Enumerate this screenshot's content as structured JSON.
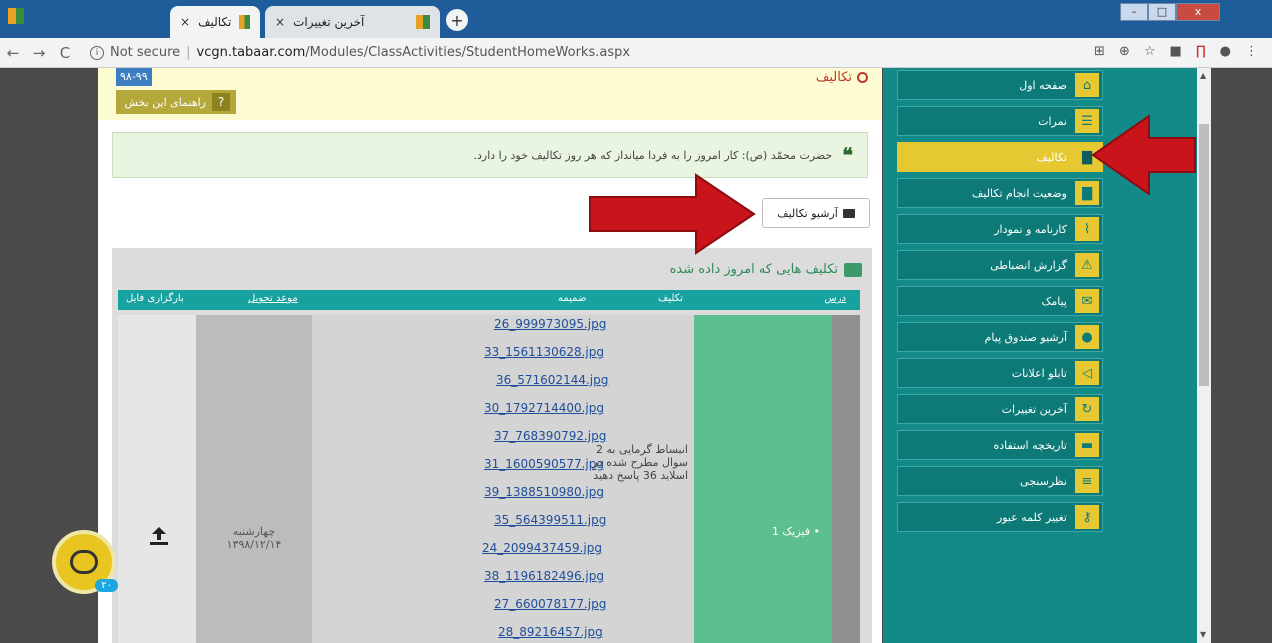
{
  "browser": {
    "tabs": [
      {
        "label": "تکالیف",
        "close": "×"
      },
      {
        "label": "آخرین تغییرات",
        "close": "×"
      }
    ],
    "new_tab": "+",
    "url_security": "Not secure",
    "url_host": "vcgn.tabaar.com",
    "url_path": "/Modules/ClassActivities/StudentHomeWorks.aspx",
    "window_controls": [
      "–",
      "□",
      "x"
    ]
  },
  "header": {
    "year_badge": "۹۸-۹۹",
    "help_label": "راهنمای این بخش",
    "help_icon": "?",
    "page_title": "تکالیف"
  },
  "quote": {
    "mark": "❝",
    "text": "حضرت محمّد (ص): کار امروز را به فردا میانداز که هر روز تکالیف خود را دارد."
  },
  "archive_button": {
    "label": "آرشیو تکالیف"
  },
  "homework": {
    "title": "تکلیف هایی که امروز داده شده",
    "columns": {
      "lesson": "درس",
      "assignment": "تکلیف",
      "attachment": "ضمیمه",
      "due": "موعد تحویل",
      "upload": "بارگزاری فایل"
    },
    "row": {
      "lesson": "فیزیک 1",
      "assignment": "انبساط گرمایی به 2 سوال مطرح شده در اسلاید 36 پاسخ دهید",
      "attachments": [
        "26_999973095.jpg",
        "33_1561130628.jpg",
        "36_571602144.jpg",
        "30_1792714400.jpg",
        "37_768390792.jpg",
        "31_1600590577.jpg",
        "39_1388510980.jpg",
        "35_564399511.jpg",
        "24_2099437459.jpg",
        "38_1196182496.jpg",
        "27_660078177.jpg",
        "28_89216457.jpg"
      ],
      "due_day": "چهارشنبه",
      "due_date": "۱۳۹۸/۱۲/۱۴"
    }
  },
  "sidebar": {
    "items": [
      {
        "label": "صفحه اول",
        "icon": "home-icon"
      },
      {
        "label": "نمرات",
        "icon": "list-icon"
      },
      {
        "label": "تکالیف",
        "icon": "book-icon",
        "active": true
      },
      {
        "label": "وضعیت انجام تکالیف",
        "icon": "book-icon"
      },
      {
        "label": "کارنامه و نمودار",
        "icon": "chart-icon"
      },
      {
        "label": "گزارش انضباطی",
        "icon": "warning-icon"
      },
      {
        "label": "پیامک",
        "icon": "envelope-icon"
      },
      {
        "label": "آرشیو صندوق پیام",
        "icon": "chat-icon"
      },
      {
        "label": "تابلو اعلانات",
        "icon": "megaphone-icon"
      },
      {
        "label": "آخرین تغییرات",
        "icon": "refresh-icon"
      },
      {
        "label": "تاریخچه استفاده",
        "icon": "archive-icon"
      },
      {
        "label": "نظرسنجی",
        "icon": "poll-icon"
      },
      {
        "label": "تغییر کلمه عبور",
        "icon": "key-icon"
      }
    ]
  },
  "chat": {
    "badge": "۲۰"
  },
  "colors": {
    "accent_teal": "#138a88",
    "accent_yellow": "#e6c832",
    "arrow_red": "#c9141b"
  }
}
